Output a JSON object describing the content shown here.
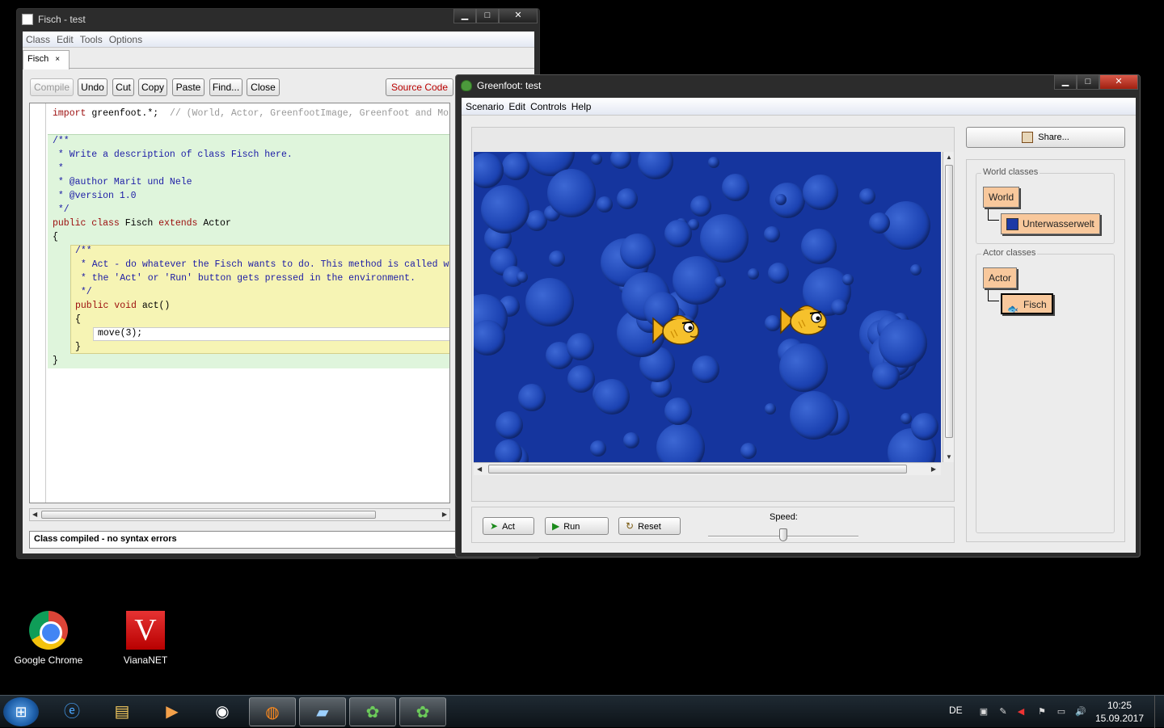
{
  "editor": {
    "title": "Fisch - test",
    "menu": [
      "Class",
      "Edit",
      "Tools",
      "Options"
    ],
    "tab_label": "Fisch",
    "tab_close": "×",
    "buttons": {
      "compile": "Compile",
      "undo": "Undo",
      "cut": "Cut",
      "copy": "Copy",
      "paste": "Paste",
      "find": "Find...",
      "close": "Close",
      "view": "Source Code"
    },
    "code": {
      "l1_kw": "import",
      "l1_text": " greenfoot.*;  ",
      "l1_comment": "// (World, Actor, GreenfootImage, Greenfoot and MouseInfo)",
      "l3": "/**",
      "l4": " * Write a description of class Fisch here.",
      "l5": " *",
      "l6": " * @author Marit und Nele",
      "l7": " * @version 1.0",
      "l8": " */",
      "l9_kw1": "public class",
      "l9_name": " Fisch ",
      "l9_kw2": "extends",
      "l9_rest": " Actor",
      "l10": "{",
      "l11": "/**",
      "l12": " * Act - do whatever the Fisch wants to do. This method is called whenever",
      "l13": " * the 'Act' or 'Run' button gets pressed in the environment.",
      "l14": " */",
      "l15_kw": "public void",
      "l15_rest": " act()",
      "l16": "{",
      "l17": "move(3);",
      "l18": "}",
      "l19": "}"
    },
    "status": "Class compiled - no syntax errors"
  },
  "greenfoot": {
    "title": "Greenfoot: test",
    "menu": [
      "Scenario",
      "Edit",
      "Controls",
      "Help"
    ],
    "share": "Share...",
    "world_classes_label": "World classes",
    "actor_classes_label": "Actor classes",
    "classes": {
      "world": "World",
      "unterwasserwelt": "Unterwasserwelt",
      "actor": "Actor",
      "fisch": "Fisch"
    },
    "controls": {
      "act": "Act",
      "run": "Run",
      "reset": "Reset",
      "speed_label": "Speed:",
      "speed_value": 0.5
    }
  },
  "desktop": {
    "icons": [
      "Google Chrome",
      "VianaNET"
    ]
  },
  "taskbar": {
    "language": "DE",
    "time": "10:25",
    "date": "15.09.2017"
  },
  "colors": {
    "world_water": "#15359e",
    "class_box": "#f8c89c",
    "code_green": "#dff5dc",
    "code_yellow": "#f6f4b4"
  }
}
